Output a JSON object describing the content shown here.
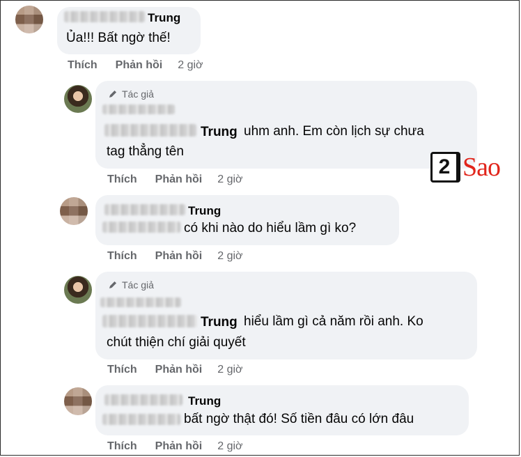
{
  "comments": [
    {
      "name": "Trung",
      "author_badge": "",
      "lines": [
        "Ủa!!! Bất ngờ thế!"
      ],
      "actions": {
        "like": "Thích",
        "reply": "Phản hồi",
        "time": "2 giờ"
      }
    },
    {
      "name": "Trung",
      "author_badge": "Tác giả",
      "lines": [
        "uhm anh. Em còn lịch sự chưa",
        "tag thẳng tên"
      ],
      "actions": {
        "like": "Thích",
        "reply": "Phản hồi",
        "time": "2 giờ"
      }
    },
    {
      "name": "Trung",
      "author_badge": "",
      "lines": [
        "có khi nào do hiểu lầm gì ko?"
      ],
      "actions": {
        "like": "Thích",
        "reply": "Phản hồi",
        "time": "2 giờ"
      }
    },
    {
      "name": "Trung",
      "author_badge": "Tác giả",
      "lines": [
        "hiểu lầm gì cả năm rồi anh. Ko",
        "chút thiện chí giải quyết"
      ],
      "actions": {
        "like": "Thích",
        "reply": "Phản hồi",
        "time": "2 giờ"
      }
    },
    {
      "name": "Trung",
      "author_badge": "",
      "lines": [
        "bất ngờ thật đó! Số tiền đâu có lớn đâu"
      ],
      "actions": {
        "like": "Thích",
        "reply": "Phản hồi",
        "time": "2 giờ"
      }
    }
  ],
  "watermark": {
    "number": "2",
    "word": "Sao"
  },
  "colors": {
    "bubble": "#f0f2f5",
    "meta": "#65676b",
    "text": "#050505",
    "logo_red": "#e1251b"
  }
}
